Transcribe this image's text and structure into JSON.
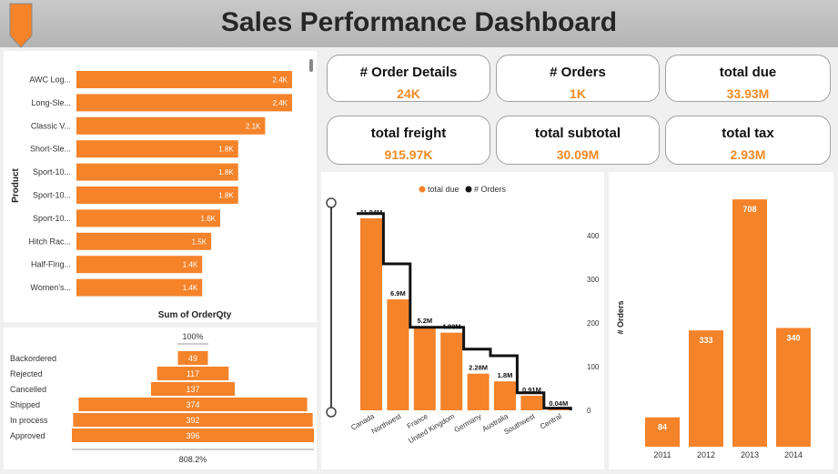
{
  "header": {
    "title": "Sales Performance Dashboard"
  },
  "colors": {
    "accent": "#f5832a",
    "line": "#111111"
  },
  "kpis": [
    {
      "label": "# Order Details",
      "value": "24K"
    },
    {
      "label": "# Orders",
      "value": "1K"
    },
    {
      "label": "total due",
      "value": "33.93M"
    },
    {
      "label": "total freight",
      "value": "915.97K"
    },
    {
      "label": "total subtotal",
      "value": "30.09M"
    },
    {
      "label": "total tax",
      "value": "2.93M"
    }
  ],
  "chart_data": [
    {
      "type": "bar",
      "orientation": "horizontal",
      "ylabel": "Product",
      "xlabel": "Sum of OrderQty",
      "categories": [
        "AWC Log...",
        "Long-Sle...",
        "Classic V...",
        "Short-Sle...",
        "Sport-10...",
        "Sport-10...",
        "Sport-10...",
        "Hitch Rac...",
        "Half-Fing...",
        "Women's..."
      ],
      "values": [
        2400,
        2400,
        2100,
        1800,
        1800,
        1800,
        1600,
        1500,
        1400,
        1400
      ],
      "labels": [
        "2.4K",
        "2.4K",
        "2.1K",
        "1.8K",
        "1.8K",
        "1.8K",
        "1.6K",
        "1.5K",
        "1.4K",
        "1.4K"
      ]
    },
    {
      "type": "funnel",
      "top_label": "100%",
      "bottom_label": "808.2%",
      "categories": [
        "Backordered",
        "Rejected",
        "Cancelled",
        "Shipped",
        "In process",
        "Approved"
      ],
      "values": [
        49,
        117,
        137,
        374,
        392,
        396
      ]
    },
    {
      "type": "bar-line",
      "legend": [
        "total due",
        "# Orders"
      ],
      "categories": [
        "Canada",
        "Northwest",
        "France",
        "United Kingdom",
        "Germany",
        "Australia",
        "Southwest",
        "Central"
      ],
      "bar_values": [
        11.94,
        6.9,
        5.2,
        4.83,
        2.28,
        1.8,
        0.91,
        0.04
      ],
      "bar_labels": [
        "11.94M",
        "6.9M",
        "5.2M",
        "4.83M",
        "2.28M",
        "1.8M",
        "0.91M",
        "0.04M"
      ],
      "line_values": [
        450,
        335,
        190,
        190,
        140,
        125,
        40,
        5
      ],
      "y2_ticks": [
        "400",
        "300",
        "200",
        "100",
        "0"
      ],
      "y2lim": [
        0,
        460
      ]
    },
    {
      "type": "bar",
      "ylabel": "# Orders",
      "categories": [
        "2011",
        "2012",
        "2013",
        "2014"
      ],
      "values": [
        84,
        333,
        708,
        340
      ],
      "ylim": [
        0,
        750
      ]
    }
  ]
}
